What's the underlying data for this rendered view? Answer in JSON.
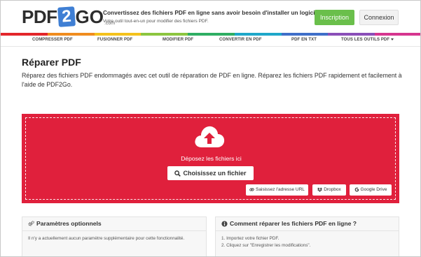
{
  "header": {
    "logo": {
      "part1": "PDF",
      "part2": "2",
      "part3": "GO",
      "suffix": ".com"
    },
    "tagline": "Convertissez des fichiers PDF en ligne sans avoir besoin d'installer un logiciel.",
    "subtagline": "Votre outil tout-en-un pour modifier des fichiers PDF.",
    "signup_label": "Inscription",
    "login_label": "Connexion"
  },
  "rainbow_colors": [
    "#e3262b",
    "#f08c1e",
    "#f4c21c",
    "#8cc640",
    "#2fae63",
    "#1ea7c9",
    "#3f6fc9",
    "#8a4fb8",
    "#d6368f"
  ],
  "nav": {
    "items": [
      {
        "label": "COMPRESSER PDF"
      },
      {
        "label": "FUSIONNER PDF"
      },
      {
        "label": "MODIFIER PDF"
      },
      {
        "label": "CONVERTIR EN PDF"
      },
      {
        "label": "PDF EN TXT"
      },
      {
        "label": "TOUS LES OUTILS PDF"
      }
    ]
  },
  "main": {
    "title": "Réparer PDF",
    "description": "Réparez des fichiers PDF endommagés avec cet outil de réparation de PDF en ligne. Réparez les fichiers PDF rapidement et facilement à l'aide de PDF2Go."
  },
  "dropzone": {
    "drop_text": "Déposez les fichiers ici",
    "choose_label": "Choisissez un fichier",
    "url_label": "Saisissez l'adresse URL",
    "dropbox_label": "Dropbox",
    "gdrive_label": "Google Drive",
    "accent_color": "#e0203c"
  },
  "options_panel": {
    "title": "Paramètres optionnels",
    "body": "Il n'y a actuellement aucun paramètre supplémentaire pour cette fonctionnalité."
  },
  "howto_panel": {
    "title": "Comment réparer les fichiers PDF en ligne ?",
    "steps": [
      "1. Importez votre fichier PDF.",
      "2. Cliquez sur \"Enregistrer les modifications\"."
    ]
  }
}
